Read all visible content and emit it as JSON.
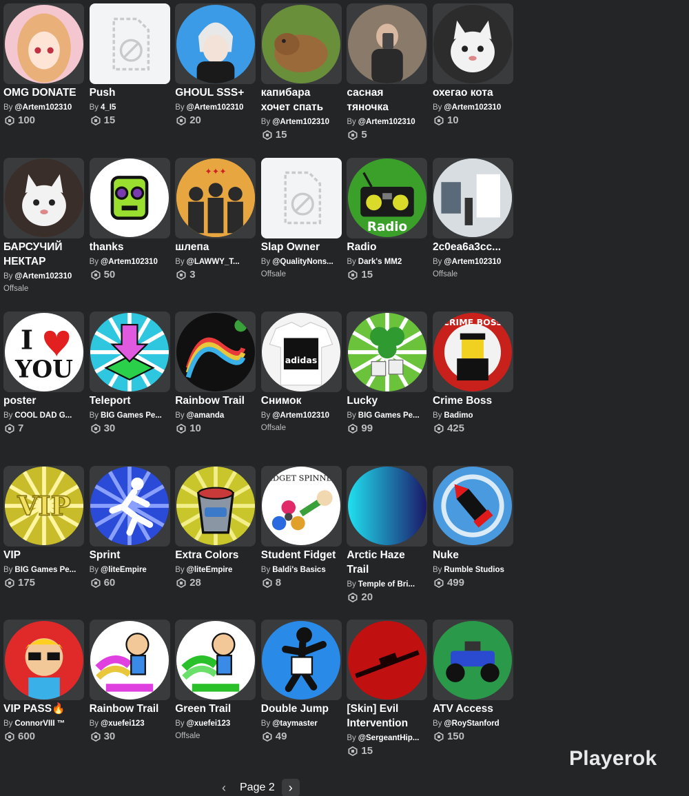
{
  "grid": {
    "items": [
      {
        "name": "OMG DONATE",
        "by": "By",
        "creator": "@Artem102310",
        "price": "100",
        "offsale": null,
        "thumb": {
          "kind": "circle",
          "bg": "#f4c6cf",
          "fg": "#e9b07a",
          "icon": "anime-girl-icon"
        }
      },
      {
        "name": "Push",
        "by": "By",
        "creator": "4_I5",
        "price": "15",
        "offsale": null,
        "thumb": {
          "kind": "placeholder",
          "bg": "#f2f4f5",
          "fg": "#c8cacc",
          "icon": "image-unavailable-icon"
        }
      },
      {
        "name": "GHOUL SSS+",
        "by": "By",
        "creator": "@Artem102310",
        "price": "20",
        "offsale": null,
        "thumb": {
          "kind": "circle",
          "bg": "#3b9be6",
          "fg": "#e8e8e8",
          "icon": "anime-boy-icon"
        }
      },
      {
        "name": "капибара хочет спать",
        "by": "By",
        "creator": "@Artem102310",
        "price": "15",
        "offsale": null,
        "thumb": {
          "kind": "circle",
          "bg": "#6a8f3a",
          "fg": "#9a6a3a",
          "icon": "capybara-icon"
        }
      },
      {
        "name": "сасная тяночка",
        "by": "By",
        "creator": "@Artem102310",
        "price": "5",
        "offsale": null,
        "thumb": {
          "kind": "circle",
          "bg": "#8a7a6a",
          "fg": "#d8b8a0",
          "icon": "person-photo-icon"
        }
      },
      {
        "name": "охегао кота",
        "by": "By",
        "creator": "@Artem102310",
        "price": "10",
        "offsale": null,
        "thumb": {
          "kind": "circle",
          "bg": "#2c2c2c",
          "fg": "#f2f2f2",
          "icon": "white-cat-icon"
        }
      },
      {
        "name": "БАРСУЧИЙ НЕКТАР",
        "by": "By",
        "creator": "@Artem102310",
        "price": null,
        "offsale": "Offsale",
        "thumb": {
          "kind": "circle",
          "bg": "#3a2e2a",
          "fg": "#f2f2f2",
          "icon": "white-cat-icon"
        }
      },
      {
        "name": "thanks",
        "by": "By",
        "creator": "@Artem102310",
        "price": "50",
        "offsale": null,
        "thumb": {
          "kind": "circle",
          "bg": "#ffffff",
          "fg": "#9adf2f",
          "icon": "green-face-icon"
        }
      },
      {
        "name": "шлепа",
        "by": "By",
        "creator": "@LAWWY_T...",
        "price": "3",
        "offsale": null,
        "thumb": {
          "kind": "circle",
          "bg": "#e8a640",
          "fg": "#2a2a2a",
          "icon": "anime-team-icon"
        }
      },
      {
        "name": "Slap Owner",
        "by": "By",
        "creator": "@QualityNons...",
        "price": null,
        "offsale": "Offsale",
        "thumb": {
          "kind": "placeholder",
          "bg": "#f2f4f5",
          "fg": "#c8cacc",
          "icon": "image-unavailable-icon"
        }
      },
      {
        "name": "Radio",
        "by": "By",
        "creator": "Dark's MM2",
        "price": "15",
        "offsale": null,
        "thumb": {
          "kind": "circle",
          "bg": "#3aa02a",
          "fg": "#1a1a1a",
          "icon": "radio-icon"
        }
      },
      {
        "name": "2c0ea6a3cc...",
        "by": "By",
        "creator": "@Artem102310",
        "price": null,
        "offsale": "Offsale",
        "thumb": {
          "kind": "circle",
          "bg": "#d8dde2",
          "fg": "#5a6a78",
          "icon": "office-photo-icon"
        }
      },
      {
        "name": "poster",
        "by": "By",
        "creator": "COOL DAD G...",
        "price": "7",
        "offsale": null,
        "thumb": {
          "kind": "circle",
          "bg": "#ffffff",
          "fg": "#e22020",
          "icon": "i-love-you-icon"
        }
      },
      {
        "name": "Teleport",
        "by": "By",
        "creator": "BIG Games Pe...",
        "price": "30",
        "offsale": null,
        "thumb": {
          "kind": "circle",
          "bg": "#2fc6e0",
          "fg": "#e05ae0",
          "icon": "teleport-arrow-icon"
        }
      },
      {
        "name": "Rainbow Trail",
        "by": "By",
        "creator": "@amanda",
        "price": "10",
        "offsale": null,
        "thumb": {
          "kind": "circle",
          "bg": "#101010",
          "fg": "#e83a3a",
          "icon": "rainbow-trail-icon"
        }
      },
      {
        "name": "Снимок",
        "by": "By",
        "creator": "@Artem102310",
        "price": null,
        "offsale": "Offsale",
        "thumb": {
          "kind": "circle",
          "bg": "#f4f4f4",
          "fg": "#111111",
          "icon": "adidas-shirt-icon"
        }
      },
      {
        "name": "Lucky",
        "by": "By",
        "creator": "BIG Games Pe...",
        "price": "99",
        "offsale": null,
        "thumb": {
          "kind": "circle",
          "bg": "#6ac33a",
          "fg": "#2f9a2f",
          "icon": "clover-dice-icon"
        }
      },
      {
        "name": "Crime Boss",
        "by": "By",
        "creator": "Badimo",
        "price": "425",
        "offsale": null,
        "thumb": {
          "kind": "circle",
          "bg": "#c8201a",
          "fg": "#111111",
          "icon": "crime-boss-icon"
        }
      },
      {
        "name": "VIP",
        "by": "By",
        "creator": "BIG Games Pe...",
        "price": "175",
        "offsale": null,
        "thumb": {
          "kind": "circle",
          "bg": "#c8bc2a",
          "fg": "#f2e060",
          "icon": "vip-icon"
        }
      },
      {
        "name": "Sprint",
        "by": "By",
        "creator": "@liteEmpire",
        "price": "60",
        "offsale": null,
        "thumb": {
          "kind": "circle",
          "bg": "#2a4ad8",
          "fg": "#ffffff",
          "icon": "running-man-icon"
        }
      },
      {
        "name": "Extra Colors",
        "by": "By",
        "creator": "@liteEmpire",
        "price": "28",
        "offsale": null,
        "thumb": {
          "kind": "circle",
          "bg": "#c8c62a",
          "fg": "#c83a3a",
          "icon": "paint-bucket-icon"
        }
      },
      {
        "name": "Student Fidget",
        "by": "By",
        "creator": "Baldi's Basics",
        "price": "8",
        "offsale": null,
        "thumb": {
          "kind": "circle",
          "bg": "#ffffff",
          "fg": "#3aa03a",
          "icon": "fidget-spinner-icon"
        }
      },
      {
        "name": "Arctic Haze Trail",
        "by": "By",
        "creator": "Temple of Bri...",
        "price": "20",
        "offsale": null,
        "thumb": {
          "kind": "circle",
          "bg": "#1a1a6a",
          "fg": "#20e0f0",
          "icon": "gradient-trail-icon"
        }
      },
      {
        "name": "Nuke",
        "by": "By",
        "creator": "Rumble Studios",
        "price": "499",
        "offsale": null,
        "thumb": {
          "kind": "circle",
          "bg": "#4a9ae0",
          "fg": "#e01a1a",
          "icon": "nuke-rocket-icon"
        }
      },
      {
        "name": "VIP PASS🔥",
        "by": "By",
        "creator": "ConnorVIII ™",
        "price": "600",
        "offsale": null,
        "thumb": {
          "kind": "circle",
          "bg": "#e02a2a",
          "fg": "#ffd020",
          "icon": "cool-guy-icon"
        }
      },
      {
        "name": "Rainbow Trail",
        "by": "By",
        "creator": "@xuefei123",
        "price": "30",
        "offsale": null,
        "thumb": {
          "kind": "circle",
          "bg": "#ffffff",
          "fg": "#e040e0",
          "icon": "rainbow-runner-icon"
        }
      },
      {
        "name": "Green Trail",
        "by": "By",
        "creator": "@xuefei123",
        "price": null,
        "offsale": "Offsale",
        "thumb": {
          "kind": "circle",
          "bg": "#ffffff",
          "fg": "#2ac02a",
          "icon": "green-runner-icon"
        }
      },
      {
        "name": "Double Jump",
        "by": "By",
        "creator": "@taymaster",
        "price": "49",
        "offsale": null,
        "thumb": {
          "kind": "circle",
          "bg": "#2a8ae8",
          "fg": "#111111",
          "icon": "jumping-figure-icon"
        }
      },
      {
        "name": "[Skin] Evil Intervention",
        "by": "By",
        "creator": "@SergeantHip...",
        "price": "15",
        "offsale": null,
        "thumb": {
          "kind": "circle",
          "bg": "#c01010",
          "fg": "#1a0000",
          "icon": "sniper-rifle-icon"
        }
      },
      {
        "name": "ATV Access",
        "by": "By",
        "creator": "@RoyStanford",
        "price": "150",
        "offsale": null,
        "thumb": {
          "kind": "circle",
          "bg": "#2a9a4a",
          "fg": "#2a4ad0",
          "icon": "atv-icon"
        }
      }
    ]
  },
  "pager": {
    "prev_label": "‹",
    "page_label": "Page 2",
    "next_label": "›"
  },
  "watermark": "Playerok",
  "colors": {
    "background": "#232527",
    "card": "#393b3d",
    "text": "#ffffff",
    "muted": "#bdbebe"
  }
}
